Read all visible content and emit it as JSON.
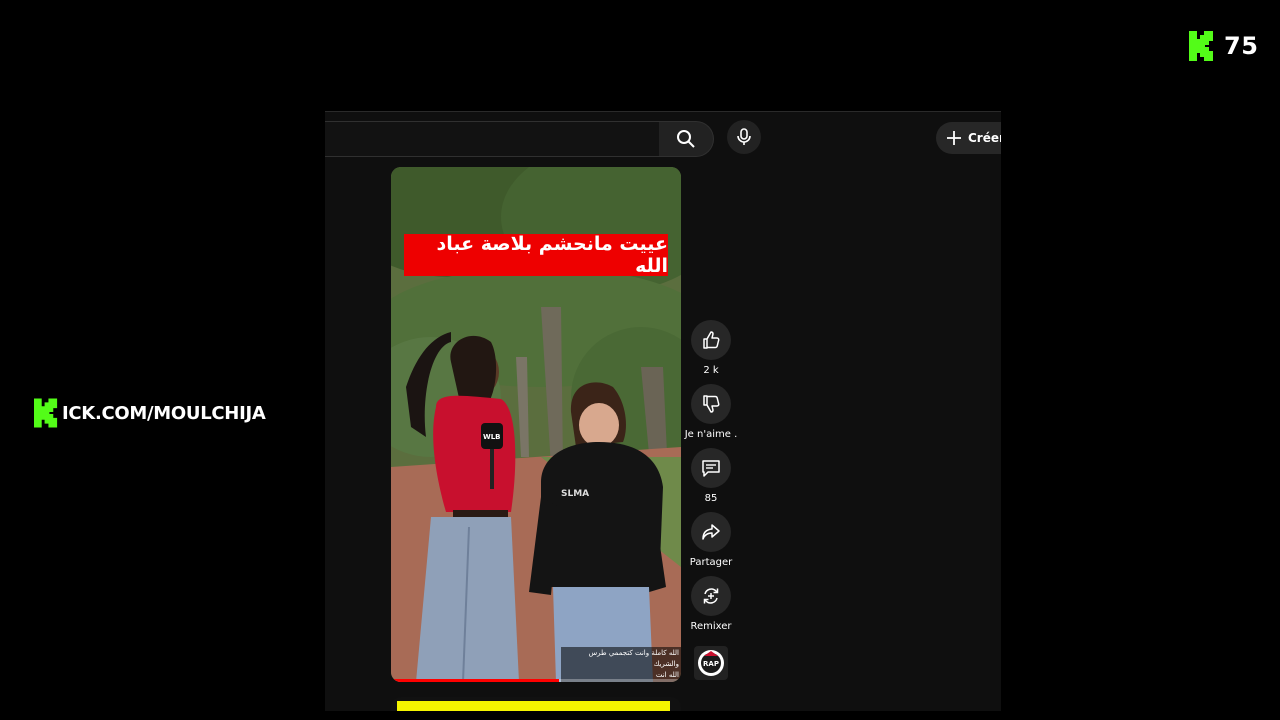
{
  "overlay": {
    "viewer_count": "75",
    "kick_url": "ICK.COM/MOULCHIJA",
    "brand_color": "#53fc18"
  },
  "toolbar": {
    "search_icon": "search-icon",
    "mic_icon": "microphone-icon",
    "create_label": "Créer"
  },
  "video": {
    "title": "عييت مانحشم بلاصة عباد الله",
    "caption_line1": "الله كاملة وانت كتجممي طرس والشريك",
    "caption_line2": "الله انت",
    "mic_logo": "WLB",
    "hoodie_text": "SLMA",
    "progress_fraction": 0.58
  },
  "actions": {
    "like_count": "2 k",
    "dislike_label": "Je n'aime .",
    "comments_count": "85",
    "share_label": "Partager",
    "remix_label": "Remixer",
    "channel_badge": "RAP"
  }
}
